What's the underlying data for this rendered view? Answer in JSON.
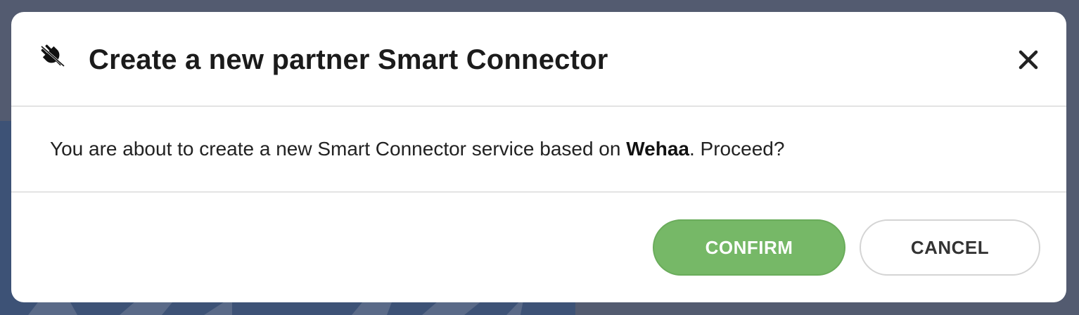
{
  "dialog": {
    "title": "Create a new partner Smart Connector",
    "icon": "plug-icon",
    "close_icon": "close-icon",
    "body": {
      "prefix": "You are about to create a new Smart Connector service based on ",
      "partner_name": "Wehaa",
      "suffix": ". Proceed?"
    },
    "buttons": {
      "confirm_label": "CONFIRM",
      "cancel_label": "CANCEL"
    }
  },
  "colors": {
    "confirm": "#76b867",
    "overlay": "#535b70",
    "background_panel": "#3d5276"
  }
}
